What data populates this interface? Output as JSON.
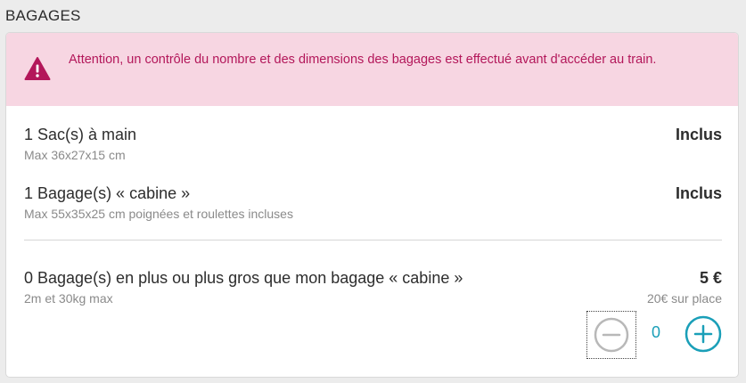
{
  "section": {
    "title": "BAGAGES"
  },
  "alert": {
    "text": "Attention, un contrôle du nombre et des dimensions des bagages est effectué avant d'accéder au train.",
    "icon": "warning-icon",
    "color": "#b3175a",
    "background": "#f7d6e2"
  },
  "items": [
    {
      "title": "1 Sac(s) à main",
      "subtitle": "Max 36x27x15 cm",
      "price": "Inclus"
    },
    {
      "title": "1 Bagage(s) « cabine »",
      "subtitle": "Max 55x35x25 cm poignées et roulettes incluses",
      "price": "Inclus"
    }
  ],
  "extra": {
    "title": "0 Bagage(s) en plus ou plus gros que mon bagage « cabine »",
    "subtitle": "2m et 30kg max",
    "price": "5 €",
    "onsite_price": "20€ sur place",
    "quantity": "0",
    "accent_color": "#1a9fb8",
    "minus_icon": "minus-circle-icon",
    "plus_icon": "plus-circle-icon"
  }
}
